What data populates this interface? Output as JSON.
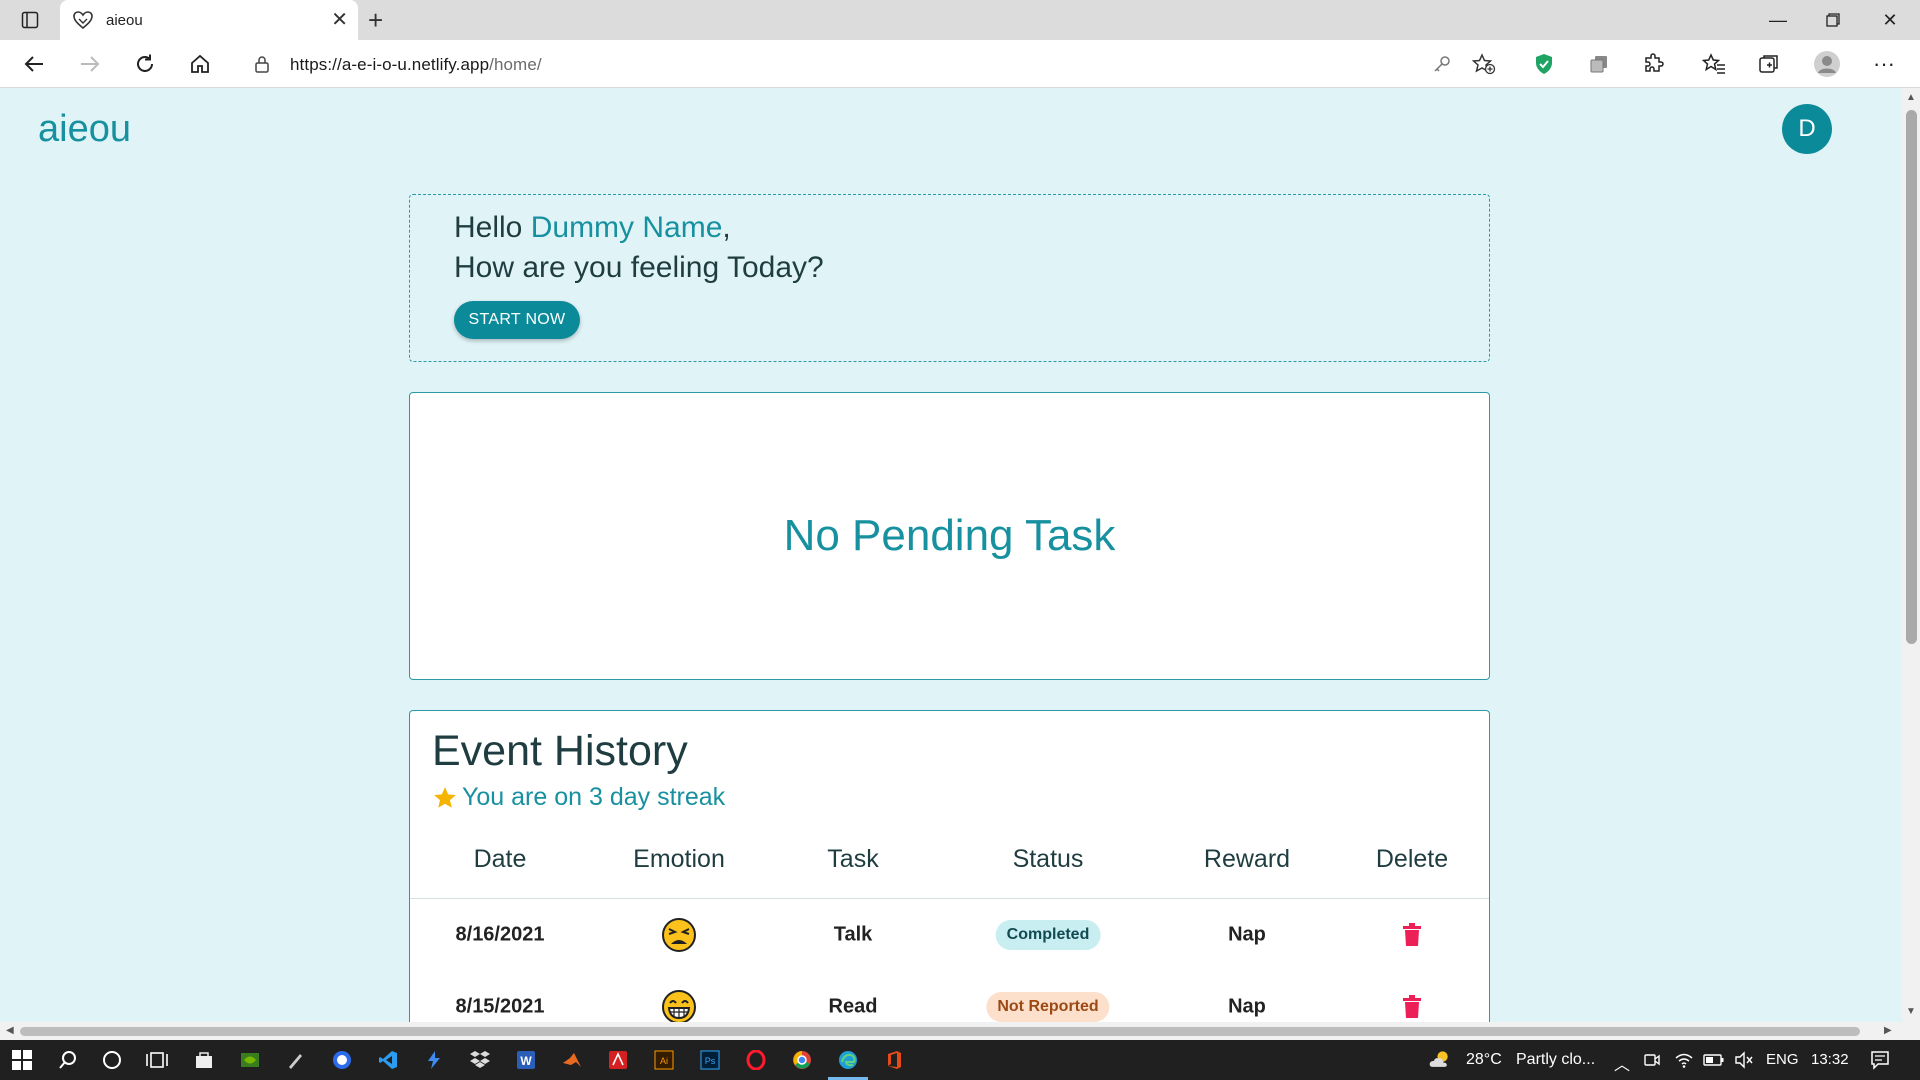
{
  "browser": {
    "tab_title": "aieou",
    "url_host": "https://a-e-i-o-u.netlify.app",
    "url_path": "/home/"
  },
  "app": {
    "brand": "aieou",
    "avatar_initial": "D",
    "accent_color": "#0b8b99"
  },
  "greeting": {
    "hello": "Hello",
    "name": "Dummy Name",
    "comma": ",",
    "question": "How are you feeling Today?",
    "start_label": "START NOW"
  },
  "pending": {
    "message": "No Pending Task"
  },
  "history": {
    "title": "Event History",
    "streak_text": "You are on 3 day streak",
    "columns": [
      "Date",
      "Emotion",
      "Task",
      "Status",
      "Reward",
      "Delete"
    ],
    "rows": [
      {
        "date": "8/16/2021",
        "emotion": "tired-face-emoji",
        "task": "Talk",
        "status": "Completed",
        "reward": "Nap"
      },
      {
        "date": "8/15/2021",
        "emotion": "grinning-face-emoji",
        "task": "Read",
        "status": "Not Reported",
        "reward": "Nap"
      }
    ]
  },
  "taskbar": {
    "temperature": "28°C",
    "weather": "Partly clo...",
    "language": "ENG",
    "time": "13:32"
  }
}
